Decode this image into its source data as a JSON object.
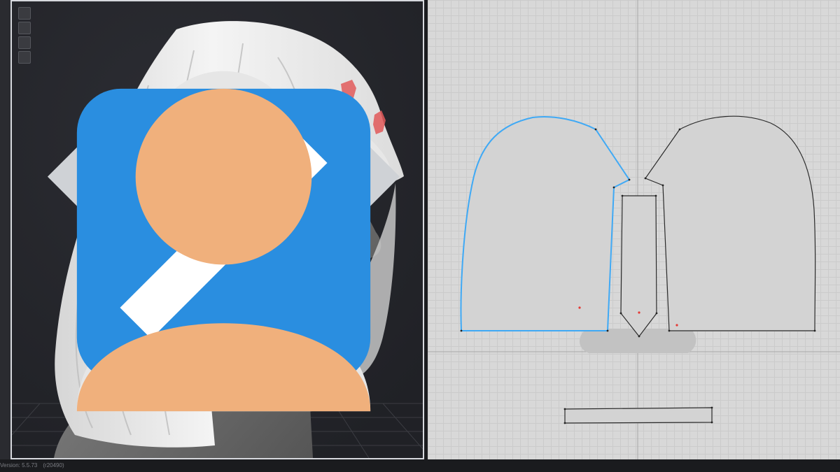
{
  "viewport_tools": [
    {
      "name": "avatar-garment-icon"
    },
    {
      "name": "avatar-body-icon"
    },
    {
      "name": "fabric-view-icon"
    },
    {
      "name": "avatar-skin-icon"
    }
  ],
  "status_bar": {
    "version": "Version: 5.5.73",
    "build": "(r20490)"
  },
  "colors": {
    "selected_outline": "#3fa9f5",
    "outline": "#2b2b2b",
    "pin_marker": "#e53935",
    "viewport_bg": "#25262b"
  }
}
